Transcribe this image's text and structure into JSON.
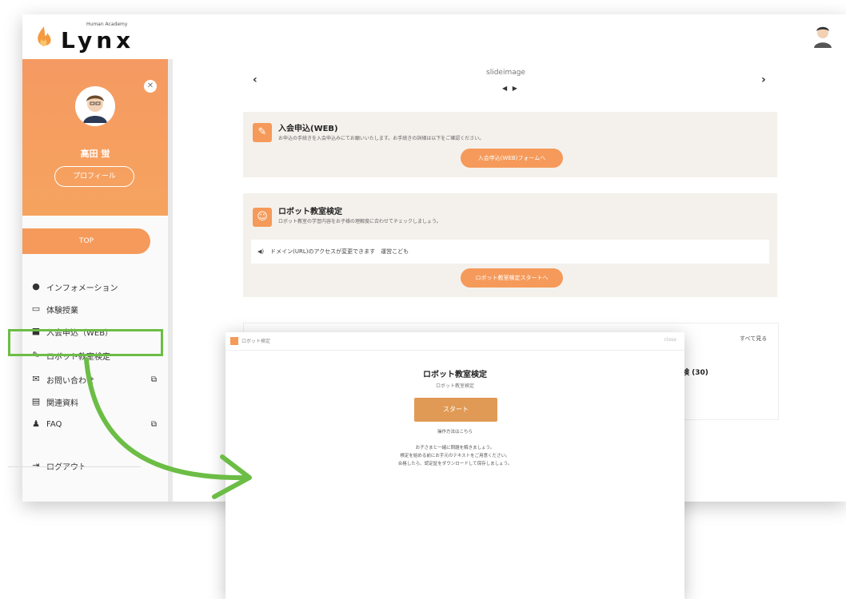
{
  "app": {
    "logo_text": "Lynx",
    "logo_subtext": "Human Academy"
  },
  "sidebar": {
    "user_name": "高田 蛍",
    "profile_button": "プロフィール",
    "close_icon": "close-icon",
    "top_button": "TOP",
    "items": [
      {
        "label": "インフォメーション",
        "icon": "info-icon"
      },
      {
        "label": "体験授業",
        "icon": "chat-icon"
      },
      {
        "label": "入会申込（WEB）",
        "icon": "form-icon"
      },
      {
        "label": "ロボット教室検定",
        "icon": "pencil-icon"
      },
      {
        "label": "お問い合わせ",
        "icon": "mail-icon",
        "external": true
      },
      {
        "label": "関連資料",
        "icon": "document-icon"
      },
      {
        "label": "FAQ",
        "icon": "faq-icon",
        "external": true
      }
    ],
    "logout": "ログアウト"
  },
  "carousel": {
    "prev": "‹",
    "next": "›",
    "image_alt": "slideimage",
    "dots": "◀ ▶"
  },
  "cards": {
    "card1": {
      "title": "入会申込(WEB)",
      "description": "お申込の手続きを入会申込みにてお願いいたします。お手続きの詳細は以下をご確認ください。",
      "button": "入会申込(WEB)フォームへ"
    },
    "card2": {
      "title": "ロボット教室検定",
      "description": "ロボット教室の学習内容をお子様の理解度に合わせてチェックしましょう。",
      "notice": "ドメイン(URL)のアクセスが変更できます　運営こども",
      "button": "ロボット教室検定スタートへ"
    },
    "card3": {
      "right_label": "すべて見る",
      "partial_text": "検 (30)"
    }
  },
  "popup": {
    "bar_label": "ロボット検定",
    "bar_right": "close",
    "title": "ロボット教室検定",
    "subtitle": "ロボット教室検定",
    "start_button": "スタート",
    "help_link": "操作方法はこちら",
    "lines": [
      "お子さまと一緒に問題を解きましょう。",
      "検定を始める前にお手元のテキストをご用意ください。",
      "合格したら、認定証をダウンロードして保存しましょう。"
    ]
  },
  "colors": {
    "orange": "#f59a5a",
    "green_annotation": "#6cbd45",
    "card_bg": "#f4f1ec"
  }
}
